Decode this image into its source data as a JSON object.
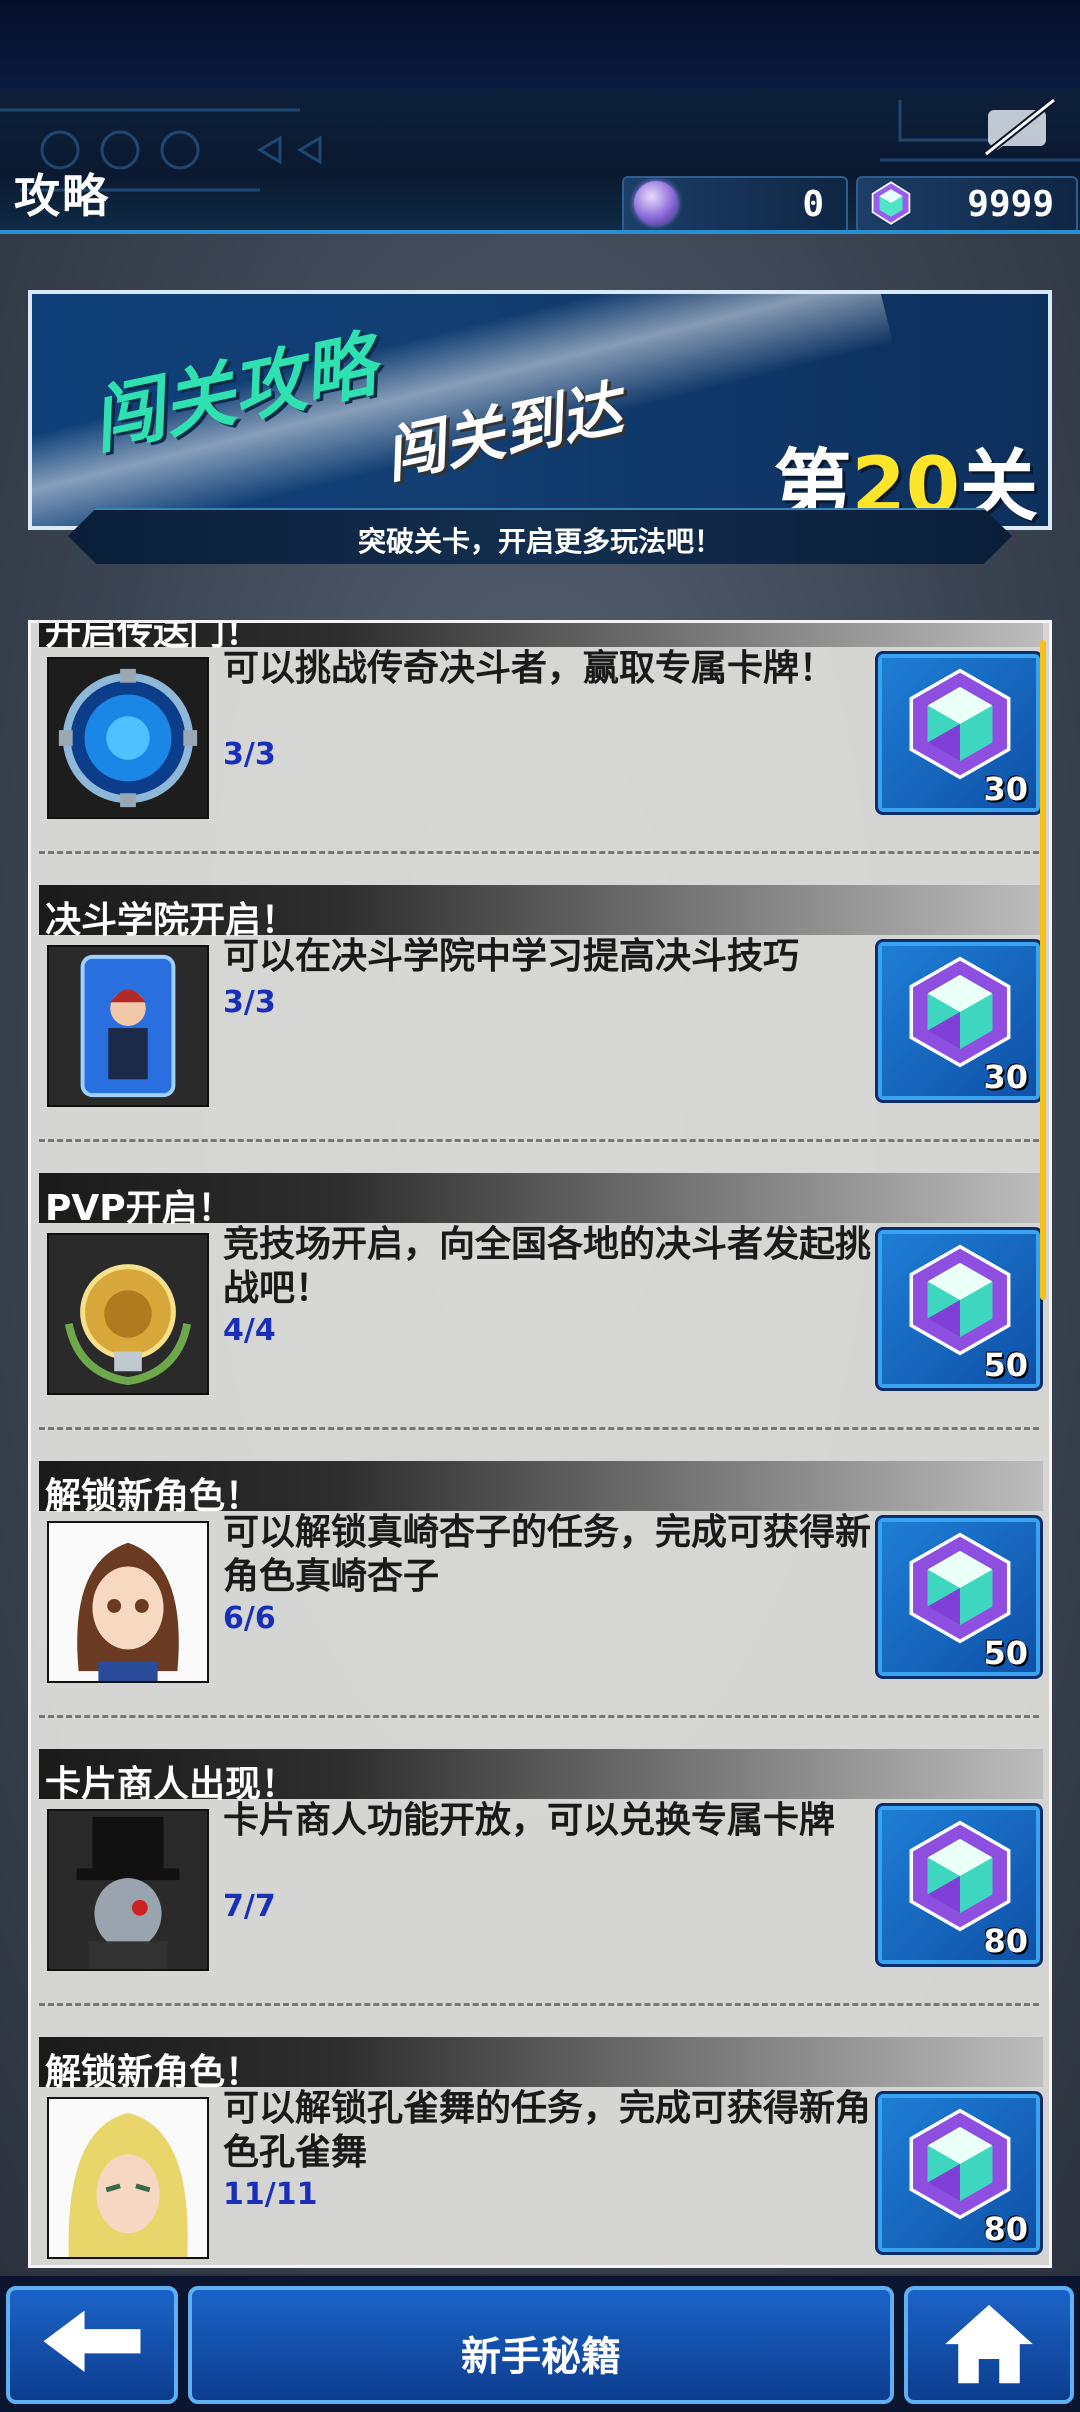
{
  "header": {
    "title": "攻略",
    "currencies": [
      {
        "icon": "orb-icon",
        "value": "0"
      },
      {
        "icon": "gem-icon",
        "value": "9999"
      }
    ]
  },
  "banner": {
    "line1": "闯关攻略",
    "line2": "闯关到达",
    "stage_prefix": "第",
    "stage_number": "20",
    "stage_suffix": "关",
    "subtitle": "突破关卡，开启更多玩法吧！"
  },
  "items": [
    {
      "title": "开启传送门！",
      "desc": "可以挑战传奇决斗者，赢取专属卡牌！",
      "progress": "3/3",
      "reward": "30",
      "thumb": "portal-icon"
    },
    {
      "title": "决斗学院开启！",
      "desc": "可以在决斗学院中学习提高决斗技巧",
      "progress": "3/3",
      "reward": "30",
      "thumb": "academy-card-icon"
    },
    {
      "title": "PVP开启！",
      "desc": "竞技场开启，向全国各地的决斗者发起挑战吧！",
      "progress": "4/4",
      "reward": "50",
      "thumb": "lion-emblem-icon"
    },
    {
      "title": "解锁新角色！",
      "desc": "可以解锁真崎杏子的任务，完成可获得新角色真崎杏子",
      "progress": "6/6",
      "reward": "50",
      "thumb": "character-portrait"
    },
    {
      "title": "卡片商人出现！",
      "desc": "卡片商人功能开放，可以兑换专属卡牌",
      "progress": "7/7",
      "reward": "80",
      "thumb": "card-merchant-portrait"
    },
    {
      "title": "解锁新角色！",
      "desc": "可以解锁孔雀舞的任务，完成可获得新角色孔雀舞",
      "progress": "11/11",
      "reward": "80",
      "thumb": "character-portrait"
    }
  ],
  "bottom_nav": {
    "back": "back-arrow-icon",
    "center_label": "新手秘籍",
    "home": "home-icon"
  },
  "colors": {
    "accent_blue": "#1b63c8",
    "progress_blue": "#1a2fb8",
    "stage_yellow": "#ffe52a",
    "scrollbar": "#f2c21a"
  }
}
